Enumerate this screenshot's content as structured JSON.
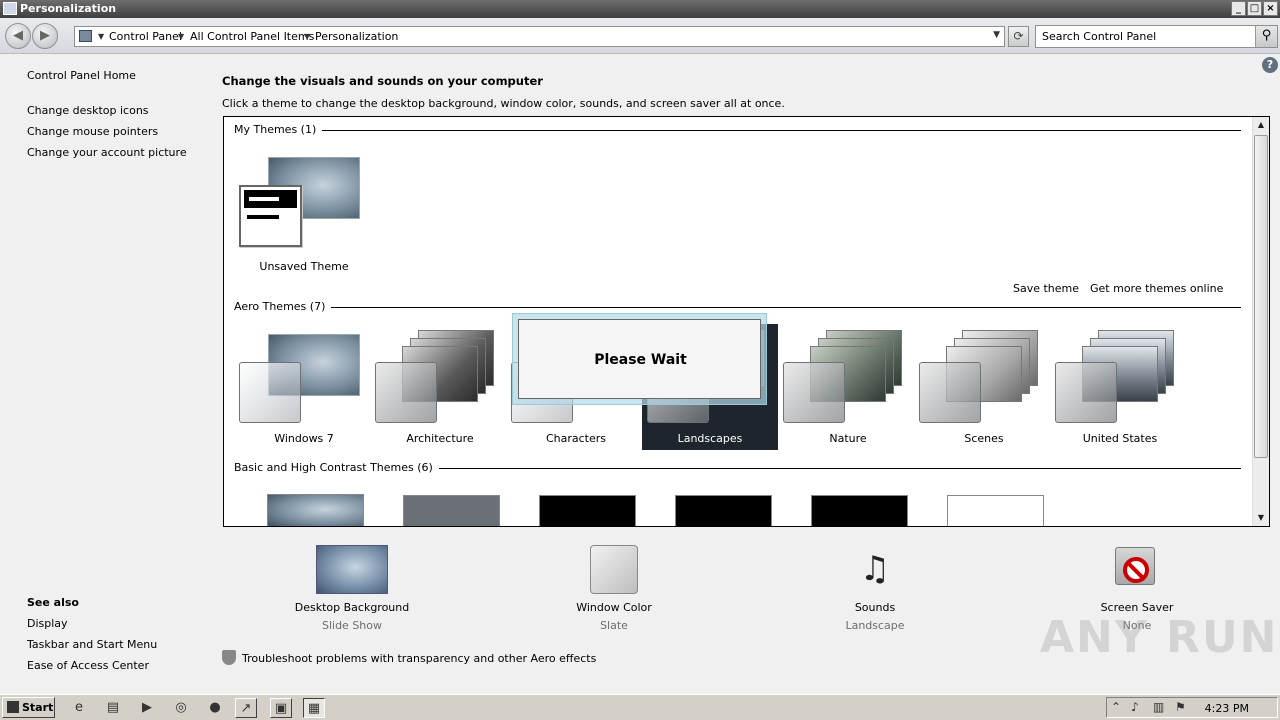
{
  "window": {
    "title": "Personalization"
  },
  "address": {
    "crumbs": [
      "Control Panel",
      "All Control Panel Items",
      "Personalization"
    ],
    "search_placeholder": "Search Control Panel"
  },
  "leftnav": {
    "home": "Control Panel Home",
    "links": [
      "Change desktop icons",
      "Change mouse pointers",
      "Change your account picture"
    ],
    "see_also_title": "See also",
    "see_also": [
      "Display",
      "Taskbar and Start Menu",
      "Ease of Access Center"
    ]
  },
  "main": {
    "heading": "Change the visuals and sounds on your computer",
    "subheading": "Click a theme to change the desktop background, window color, sounds, and screen saver all at once.",
    "my_themes_title": "My Themes (1)",
    "unsaved_theme": "Unsaved Theme",
    "save_theme": "Save theme",
    "get_more": "Get more themes online",
    "aero_title": "Aero Themes (7)",
    "aero_themes": [
      "Windows 7",
      "Architecture",
      "Characters",
      "Landscapes",
      "Nature",
      "Scenes",
      "United States"
    ],
    "selected_theme": "Landscapes",
    "basic_title": "Basic and High Contrast Themes (6)"
  },
  "dialog": {
    "text": "Please Wait"
  },
  "bottom": {
    "items": [
      {
        "label": "Desktop Background",
        "value": "Slide Show"
      },
      {
        "label": "Window Color",
        "value": "Slate"
      },
      {
        "label": "Sounds",
        "value": "Landscape"
      },
      {
        "label": "Screen Saver",
        "value": "None"
      }
    ],
    "troubleshoot": "Troubleshoot problems with transparency and other Aero effects"
  },
  "taskbar": {
    "start": "Start",
    "clock": "4:23 PM"
  },
  "watermark": "ANY RUN"
}
